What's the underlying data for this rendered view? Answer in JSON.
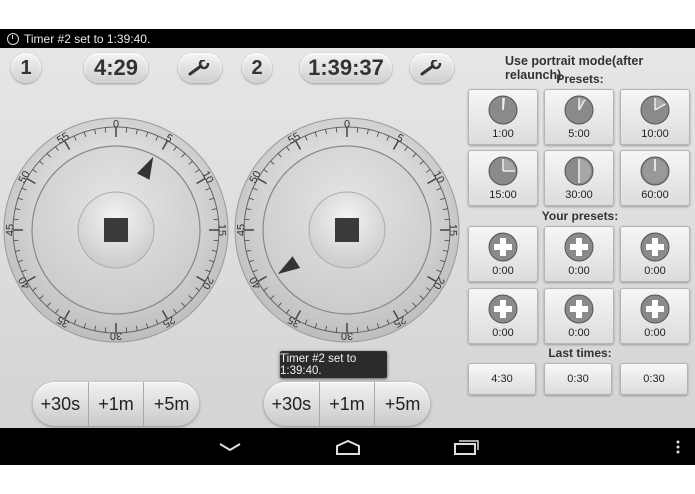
{
  "status_bar": {
    "notification_text": "Timer #2 set to 1:39:40."
  },
  "timers": [
    {
      "number": "1",
      "time": "4:29",
      "needle_minutes": 4.5,
      "add_buttons": [
        "+30s",
        "+1m",
        "+5m"
      ]
    },
    {
      "number": "2",
      "time": "1:39:37",
      "needle_minutes": 39.6,
      "add_buttons": [
        "+30s",
        "+1m",
        "+5m"
      ]
    }
  ],
  "dial": {
    "labels": [
      "0",
      "5",
      "10",
      "15",
      "20",
      "25",
      "30",
      "35",
      "40",
      "45",
      "50",
      "55"
    ]
  },
  "toast": {
    "text": "Timer #2 set to 1:39:40."
  },
  "right_panel": {
    "portrait_label": "Use portrait mode(after relaunch)",
    "presets_label": "Presets:",
    "presets": [
      {
        "label": "1:00",
        "minutes": 1
      },
      {
        "label": "5:00",
        "minutes": 5
      },
      {
        "label": "10:00",
        "minutes": 10
      },
      {
        "label": "15:00",
        "minutes": 15
      },
      {
        "label": "30:00",
        "minutes": 30
      },
      {
        "label": "60:00",
        "minutes": 60
      }
    ],
    "your_presets_label": "Your presets:",
    "your_presets": [
      "0:00",
      "0:00",
      "0:00",
      "0:00",
      "0:00",
      "0:00"
    ],
    "last_times_label": "Last times:",
    "last_times": [
      "4:30",
      "0:30",
      "0:30"
    ]
  },
  "icons": {
    "status": "alarm-clock-icon",
    "settings": "wrench-icon",
    "stop": "stop-icon",
    "add": "plus-icon",
    "nav": [
      "back-icon",
      "home-icon",
      "recent-apps-icon",
      "overflow-menu-icon"
    ]
  }
}
